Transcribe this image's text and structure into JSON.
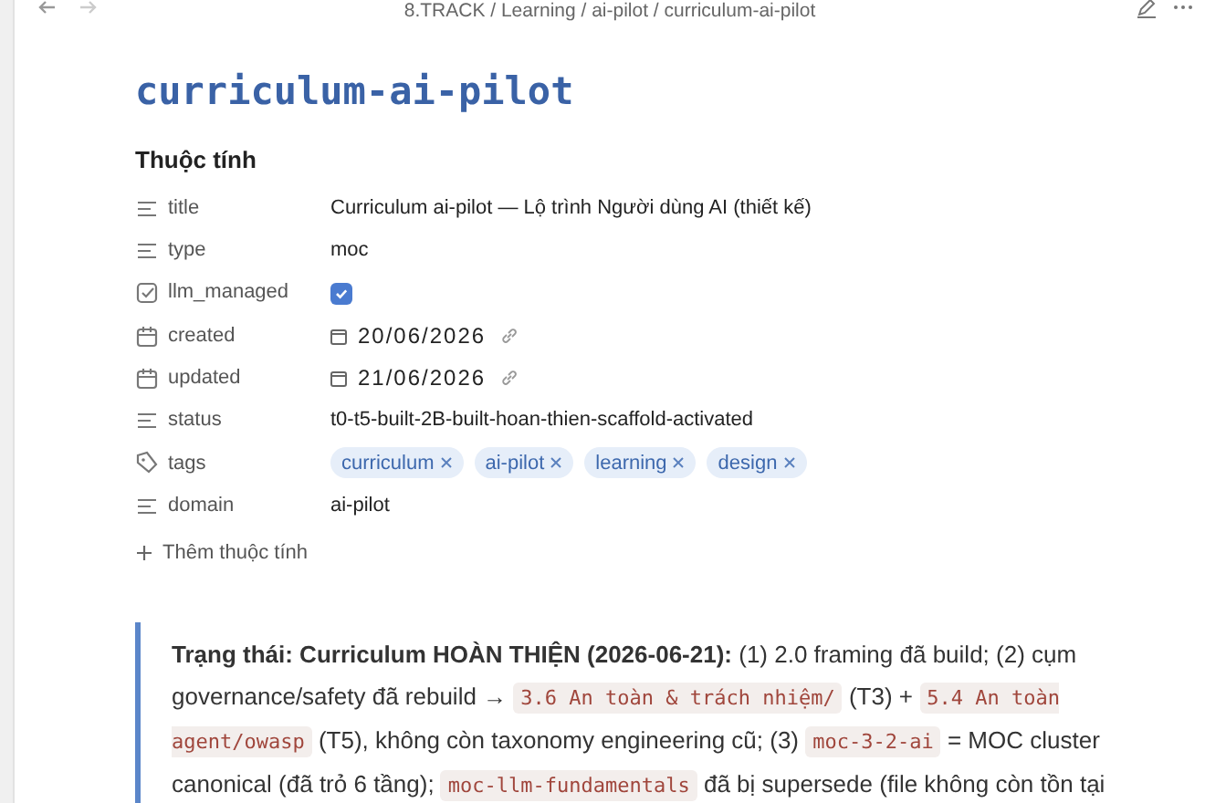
{
  "breadcrumb": "8.TRACK / Learning / ai-pilot / curriculum-ai-pilot",
  "title": "curriculum-ai-pilot",
  "properties_heading": "Thuộc tính",
  "properties": [
    {
      "kind": "text",
      "name": "title",
      "value": "Curriculum ai-pilot — Lộ trình Người dùng AI (thiết kế)"
    },
    {
      "kind": "text",
      "name": "type",
      "value": "moc"
    },
    {
      "kind": "checkbox",
      "name": "llm_managed",
      "checked": true
    },
    {
      "kind": "date",
      "name": "created",
      "value": "20/06/2026"
    },
    {
      "kind": "date",
      "name": "updated",
      "value": "21/06/2026"
    },
    {
      "kind": "text",
      "name": "status",
      "value": "t0-t5-built-2B-built-hoan-thien-scaffold-activated"
    },
    {
      "kind": "tags",
      "name": "tags",
      "tags": [
        "curriculum",
        "ai-pilot",
        "learning",
        "design"
      ]
    },
    {
      "kind": "text",
      "name": "domain",
      "value": "ai-pilot"
    }
  ],
  "add_property": "Thêm thuộc tính",
  "callout": [
    {
      "kind": "bold",
      "text": "Trạng thái: Curriculum HOÀN THIỆN (2026-06-21):"
    },
    {
      "kind": "text",
      "text": " (1) 2.0 framing đã build; (2) cụm governance/safety đã rebuild → "
    },
    {
      "kind": "code",
      "text": "3.6 An toàn & trách nhiệm/"
    },
    {
      "kind": "text",
      "text": " (T3) + "
    },
    {
      "kind": "code",
      "text": "5.4 An toàn agent/owasp"
    },
    {
      "kind": "text",
      "text": " (T5), không còn taxonomy engineering cũ; (3) "
    },
    {
      "kind": "code",
      "text": "moc-3-2-ai"
    },
    {
      "kind": "text",
      "text": " = MOC cluster canonical (đã trỏ 6 tầng); "
    },
    {
      "kind": "code",
      "text": "moc-llm-fundamentals"
    },
    {
      "kind": "text",
      "text": " đã bị supersede (file không còn tồn tại"
    }
  ]
}
